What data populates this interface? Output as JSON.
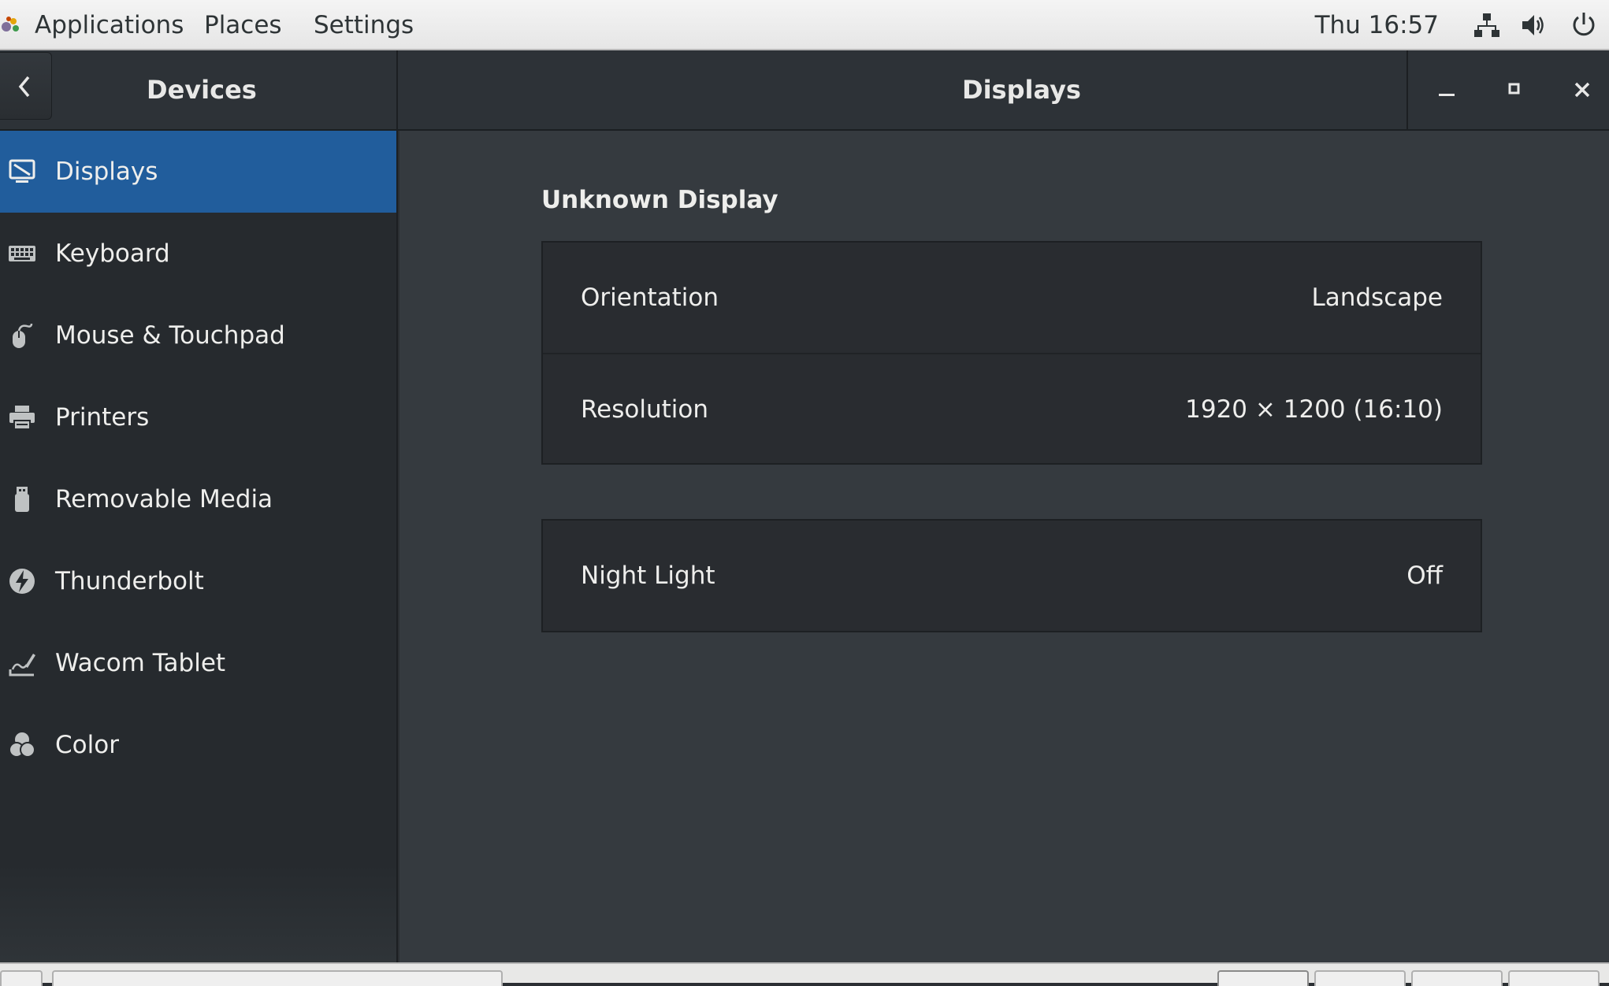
{
  "topbar": {
    "menus": [
      "Applications",
      "Places",
      "Settings"
    ],
    "clock": "Thu 16:57",
    "icons": [
      "network-icon",
      "volume-icon",
      "power-icon"
    ]
  },
  "header": {
    "section_title": "Devices",
    "page_title": "Displays",
    "back_icon": "chevron-left-icon",
    "window_controls": [
      "minimize-icon",
      "maximize-icon",
      "close-icon"
    ]
  },
  "sidebar": {
    "items": [
      {
        "label": "Displays",
        "icon": "display-icon",
        "active": true
      },
      {
        "label": "Keyboard",
        "icon": "keyboard-icon",
        "active": false
      },
      {
        "label": "Mouse & Touchpad",
        "icon": "mouse-icon",
        "active": false
      },
      {
        "label": "Printers",
        "icon": "printer-icon",
        "active": false
      },
      {
        "label": "Removable Media",
        "icon": "usb-drive-icon",
        "active": false
      },
      {
        "label": "Thunderbolt",
        "icon": "thunderbolt-icon",
        "active": false
      },
      {
        "label": "Wacom Tablet",
        "icon": "tablet-icon",
        "active": false
      },
      {
        "label": "Color",
        "icon": "color-icon",
        "active": false
      }
    ]
  },
  "main": {
    "display_name": "Unknown Display",
    "display_settings": [
      {
        "label": "Orientation",
        "value": "Landscape"
      },
      {
        "label": "Resolution",
        "value": "1920 × 1200 (16:10)"
      }
    ],
    "night_light": {
      "label": "Night Light",
      "value": "Off"
    }
  },
  "colors": {
    "accent": "#215d9c",
    "sidebar_bg": "#262a2e",
    "content_bg": "#353a3f",
    "topbar_bg": "#ededed"
  }
}
